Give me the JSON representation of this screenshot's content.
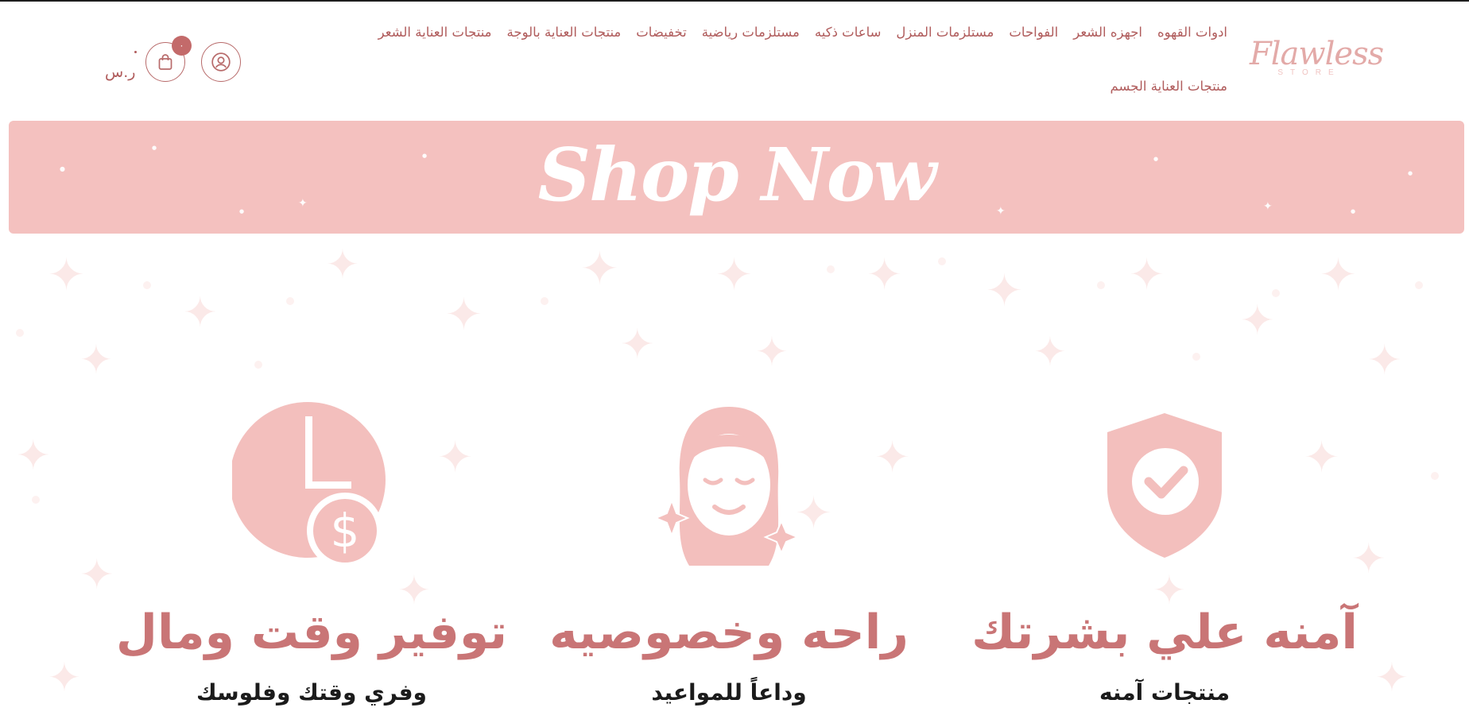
{
  "header": {
    "logo": {
      "text": "Flawless",
      "subtext": "STORE"
    },
    "nav": [
      "ادوات القهوه",
      "اجهزه الشعر",
      "الفواحات",
      "مستلزمات المنزل",
      "ساعات ذكيه",
      "مستلزمات رياضية",
      "تخفيضات",
      "منتجات العناية بالوجة",
      "منتجات العناية الشعر",
      "منتجات العناية الجسم"
    ],
    "cart": {
      "badge": "٠",
      "total": "ر.س"
    },
    "icons": {
      "account": "user-circle-icon",
      "cart": "shopping-bag-icon"
    }
  },
  "banner": {
    "text": "Shop Now"
  },
  "features": [
    {
      "icon": "shield-check-icon",
      "title": "آمنه علي بشرتك",
      "subtitle": "منتجات آمنه",
      "description": ""
    },
    {
      "icon": "face-mask-icon",
      "title": "راحه وخصوصيه",
      "subtitle": "وداعاً للمواعيد",
      "description": ""
    },
    {
      "icon": "clock-money-icon",
      "title": "توفير وقت ومال",
      "subtitle": "وفري وقتك وفلوسك",
      "description": ""
    }
  ],
  "colors": {
    "accent": "#b86b6b",
    "banner": "#f4c1bf",
    "icon_fill": "#f3bfbd",
    "title": "#c97576",
    "text": "#1b1b1b"
  }
}
